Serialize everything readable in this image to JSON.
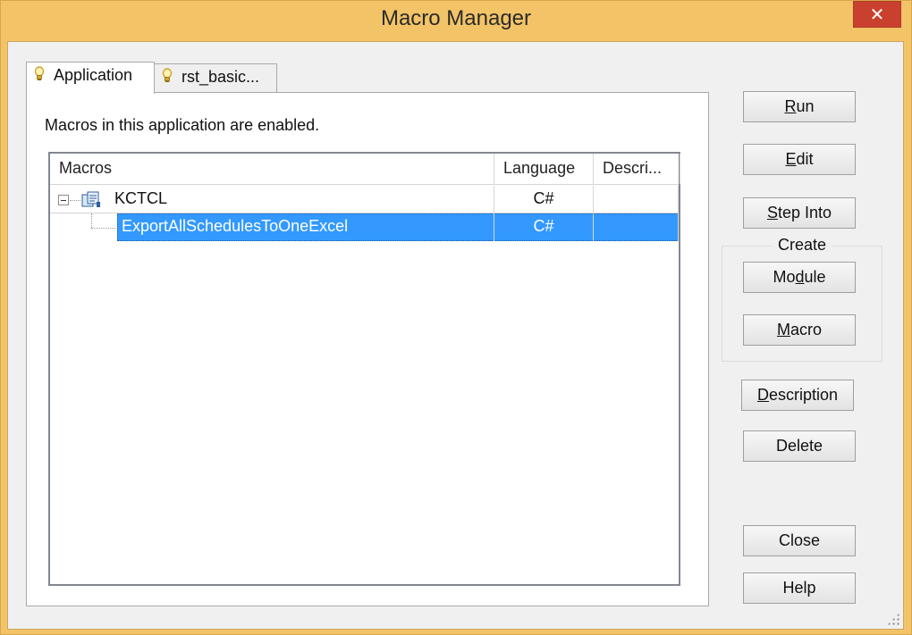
{
  "window": {
    "title": "Macro Manager",
    "close_glyph": "✕"
  },
  "tabs": [
    {
      "label": "Application",
      "icon": "lightbulb-icon",
      "active": true
    },
    {
      "label": "rst_basic...",
      "icon": "lightbulb-icon",
      "active": false
    }
  ],
  "panel": {
    "status_message": "Macros in this application are enabled.",
    "columns": [
      "Macros",
      "Language",
      "Descri..."
    ],
    "rows": [
      {
        "name": "KCTCL",
        "language": "C#",
        "description": "",
        "type": "module",
        "expanded": true
      },
      {
        "name": "ExportAllSchedulesToOneExcel",
        "language": "C#",
        "description": "",
        "type": "macro",
        "selected": true
      }
    ]
  },
  "buttons": {
    "run": {
      "mnemonic": "R",
      "rest": "un"
    },
    "edit": {
      "mnemonic": "E",
      "rest": "dit"
    },
    "step_into": {
      "mnemonic": "S",
      "rest": "tep Into"
    },
    "create_group_label": "Create",
    "module": {
      "before": "Mo",
      "mnemonic": "d",
      "rest": "ule"
    },
    "macro": {
      "mnemonic": "M",
      "rest": "acro"
    },
    "description": {
      "mnemonic": "D",
      "rest": "escription"
    },
    "delete": "Delete",
    "close": "Close",
    "help": "Help"
  },
  "colors": {
    "title_bar": "#f3c467",
    "close_button": "#c9412e",
    "selection": "#3399ff"
  }
}
